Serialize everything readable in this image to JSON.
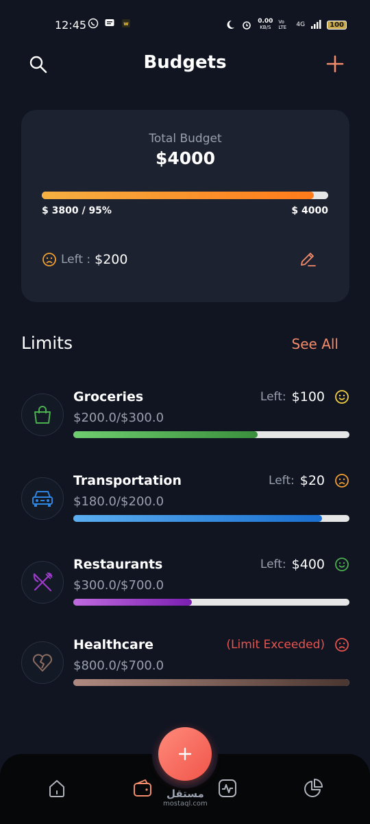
{
  "status_bar": {
    "time": "12:45",
    "network_speed": "0.00",
    "network_unit": "KB/S",
    "volte": "Vo LTE",
    "signal": "4G",
    "battery": "100"
  },
  "header": {
    "title": "Budgets",
    "search_icon": "search-icon",
    "add_icon": "plus-icon"
  },
  "budget_card": {
    "label": "Total Budget",
    "amount": "$4000",
    "progress_fraction": 0.95,
    "spent_text": "$ 3800 / 95%",
    "max_text": "$ 4000",
    "left_label": "Left :",
    "left_value": "$200",
    "accent_color": "#ff7a1a"
  },
  "limits": {
    "title": "Limits",
    "see_all": "See All",
    "items": [
      {
        "name": "Groceries",
        "amount": "$200.0/$300.0",
        "left_label": "Left:",
        "left_value": "$100",
        "exceeded_text": "",
        "progress_fraction": 0.667,
        "color": "#4caf50",
        "icon": "shopping-bag-icon",
        "mood": "happy",
        "mood_color": "#f5d142"
      },
      {
        "name": "Transportation",
        "amount": "$180.0/$200.0",
        "left_label": "Left:",
        "left_value": "$20",
        "exceeded_text": "",
        "progress_fraction": 0.9,
        "color": "#2f86e0",
        "icon": "car-icon",
        "mood": "sad",
        "mood_color": "#f0a030"
      },
      {
        "name": "Restaurants",
        "amount": "$300.0/$700.0",
        "left_label": "Left:",
        "left_value": "$400",
        "exceeded_text": "",
        "progress_fraction": 0.4286,
        "color": "#9c3bc9",
        "icon": "fork-knife-icon",
        "mood": "happy",
        "mood_color": "#4caf50"
      },
      {
        "name": "Healthcare",
        "amount": "$800.0/$700.0",
        "left_label": "",
        "left_value": "",
        "exceeded_text": "(Limit Exceeded)",
        "progress_fraction": 1.0,
        "color": "#8d6e63",
        "icon": "broken-heart-icon",
        "mood": "sad",
        "mood_color": "#e8544e"
      }
    ]
  },
  "bottom_nav": {
    "items": [
      "home-icon",
      "wallet-icon",
      "activity-icon",
      "pie-chart-icon"
    ],
    "active": "wallet-icon",
    "fab_icon": "plus-icon",
    "watermark_ar": "مستقل",
    "watermark": "mostaql.com"
  }
}
